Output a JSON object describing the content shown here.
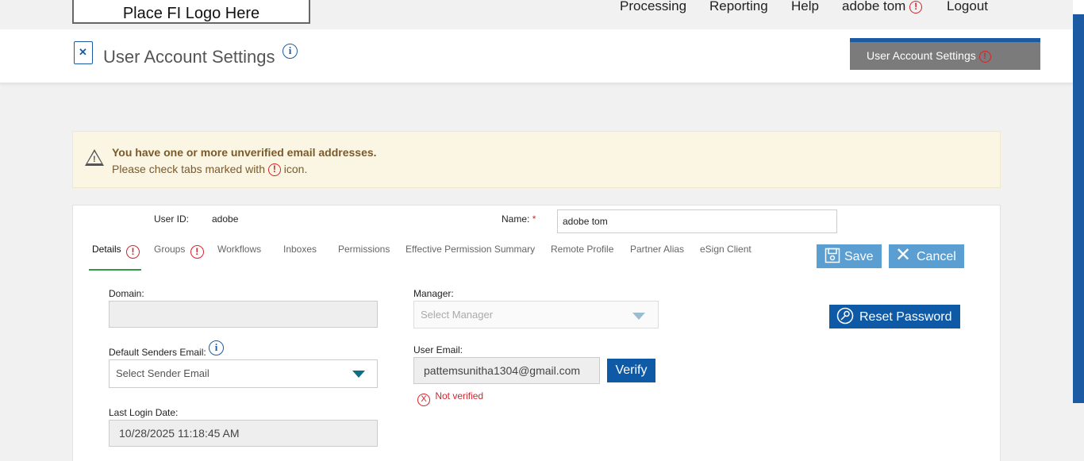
{
  "nav": {
    "logo": "Place FI Logo Here",
    "items": [
      "Processing",
      "Reporting",
      "Help",
      "adobe tom",
      "Logout"
    ]
  },
  "header": {
    "title": "User Account Settings",
    "tab_label": "User Account Settings"
  },
  "alert": {
    "title": "You have one or more unverified email addresses.",
    "text_before": "Please check tabs marked with",
    "text_after": "icon."
  },
  "user": {
    "user_id_label": "User ID:",
    "user_id": "adobe",
    "name_label": "Name:",
    "name_required": "*",
    "name_value": "adobe tom"
  },
  "tabs": [
    {
      "label": "Details"
    },
    {
      "label": "Groups"
    },
    {
      "label": "Workflows"
    },
    {
      "label": "Inboxes"
    },
    {
      "label": "Permissions"
    },
    {
      "label": "Effective Permission Summary"
    },
    {
      "label": "Remote Profile"
    },
    {
      "label": "Partner Alias"
    },
    {
      "label": "eSign Client"
    }
  ],
  "actions": {
    "save": "Save",
    "cancel": "Cancel",
    "reset_password": "Reset Password",
    "verify": "Verify"
  },
  "form": {
    "domain_label": "Domain:",
    "domain_value": "",
    "manager_label": "Manager:",
    "manager_placeholder": "Select Manager",
    "senders_label": "Default Senders Email:",
    "senders_placeholder": "Select Sender Email",
    "user_email_label": "User Email:",
    "user_email_value": "pattemsunitha1304@gmail.com",
    "not_verified": "Not verified",
    "last_login_label": "Last Login Date:",
    "last_login_value": "10/28/2025 11:18:45 AM"
  },
  "colors": {
    "accent": "#1c5ba3",
    "warning": "#d9222a",
    "active_tab": "#2e9b4a",
    "alert_bg": "#fbf6e3"
  }
}
